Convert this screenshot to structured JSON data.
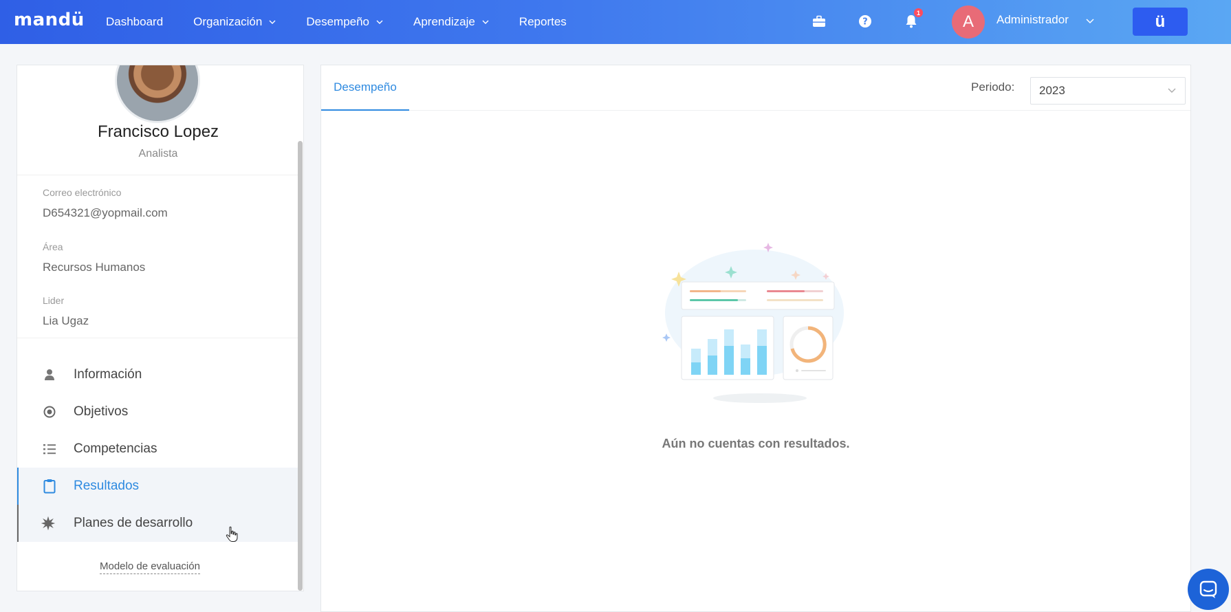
{
  "topbar": {
    "logo": "mandü",
    "nav": [
      {
        "label": "Dashboard",
        "has_dropdown": false
      },
      {
        "label": "Organización",
        "has_dropdown": true
      },
      {
        "label": "Desempeño",
        "has_dropdown": true
      },
      {
        "label": "Aprendizaje",
        "has_dropdown": true
      },
      {
        "label": "Reportes",
        "has_dropdown": false
      }
    ],
    "notification_count": "1",
    "user": {
      "initial": "A",
      "name": "Administrador"
    },
    "brand_button": "ü",
    "icons": [
      "briefcase-icon",
      "help-icon",
      "bell-icon"
    ]
  },
  "profile": {
    "name": "Francisco Lopez",
    "role": "Analista",
    "fields": [
      {
        "label": "Correo electrónico",
        "value": "D654321@yopmail.com"
      },
      {
        "label": "Área",
        "value": "Recursos Humanos"
      },
      {
        "label": "Lider",
        "value": "Lia Ugaz"
      }
    ],
    "menu": [
      {
        "label": "Información",
        "icon": "user-icon",
        "state": "normal"
      },
      {
        "label": "Objetivos",
        "icon": "target-icon",
        "state": "normal"
      },
      {
        "label": "Competencias",
        "icon": "list-icon",
        "state": "normal"
      },
      {
        "label": "Resultados",
        "icon": "clipboard-icon",
        "state": "active"
      },
      {
        "label": "Planes de desarrollo",
        "icon": "star-burst-icon",
        "state": "hover"
      }
    ],
    "model_link": "Modelo de evaluación"
  },
  "main": {
    "tab": "Desempeño",
    "period_label": "Periodo:",
    "period_value": "2023",
    "empty_message": "Aún no cuentas con resultados."
  },
  "colors": {
    "accent": "#2e8ae0",
    "topbar_start": "#2f5fe6",
    "topbar_end": "#5aa7f3",
    "badge": "#ff4d5e",
    "avatar": "#e86b77",
    "chat": "#1d63d8"
  }
}
